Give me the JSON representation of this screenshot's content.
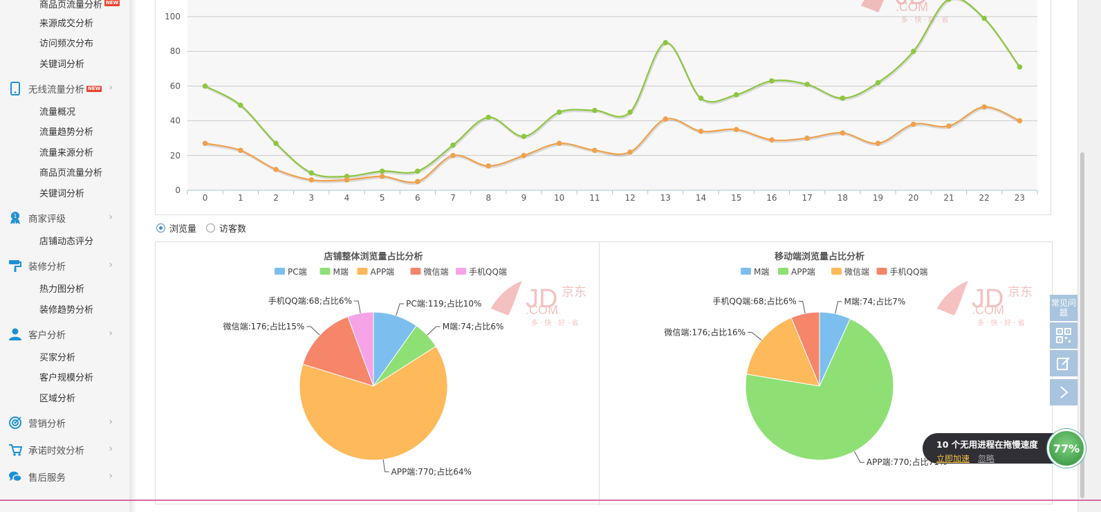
{
  "sidebar": {
    "top_item": {
      "label": "商品页流量分析",
      "badge": "NEW"
    },
    "group1_items": [
      "来源成交分析",
      "访问频次分布",
      "关键词分析"
    ],
    "wireless": {
      "label": "无线流量分析",
      "badge": "NEW",
      "items": [
        "流量概况",
        "流量趋势分析",
        "流量来源分析",
        "商品页流量分析",
        "关键词分析"
      ]
    },
    "rating": {
      "label": "商家评级",
      "items": [
        "店铺动态评分"
      ]
    },
    "decor": {
      "label": "装修分析",
      "items": [
        "热力图分析",
        "装修趋势分析"
      ]
    },
    "customer": {
      "label": "客户分析",
      "items": [
        "买家分析",
        "客户规模分析",
        "区域分析"
      ]
    },
    "marketing": {
      "label": "营销分析"
    },
    "promise": {
      "label": "承诺时效分析"
    },
    "aftersale": {
      "label": "售后服务"
    },
    "arrow": "›"
  },
  "radios": [
    {
      "label": "浏览量",
      "checked": true
    },
    {
      "label": "访客数",
      "checked": false
    }
  ],
  "watermark": {
    "jd": "JD",
    "cn": "京东",
    "com": ".COM",
    "slogan": "多 · 快 · 好 · 省"
  },
  "colors": {
    "green": "#8dc63f",
    "orange": "#f0a04b",
    "pc": "#7cbfef",
    "m": "#8ee074",
    "app": "#fdb95a",
    "wechat": "#f6866a",
    "qq": "#f7a3e8"
  },
  "chart_data": [
    {
      "type": "line",
      "x": [
        0,
        1,
        2,
        3,
        4,
        5,
        6,
        7,
        8,
        9,
        10,
        11,
        12,
        13,
        14,
        15,
        16,
        17,
        18,
        19,
        20,
        21,
        22,
        23
      ],
      "ylim": [
        0,
        110
      ],
      "yticks": [
        0,
        20,
        40,
        60,
        80,
        100
      ],
      "grid": true,
      "series": [
        {
          "values": [
            60,
            49,
            27,
            10,
            8,
            11,
            11,
            26,
            42,
            31,
            45,
            46,
            45,
            85,
            53,
            55,
            63,
            61,
            53,
            62,
            80,
            110,
            99,
            71
          ]
        },
        {
          "values": [
            27,
            23,
            12,
            6,
            6,
            8,
            5,
            20,
            14,
            20,
            27,
            23,
            22,
            41,
            34,
            35,
            29,
            30,
            33,
            27,
            38,
            37,
            48,
            40
          ]
        }
      ]
    },
    {
      "type": "pie",
      "title": "店铺整体浏览量占比分析",
      "legend": [
        "PC端",
        "M端",
        "APP端",
        "微信端",
        "手机QQ端"
      ],
      "values": [
        119,
        74,
        770,
        176,
        68
      ],
      "labels": [
        "PC端:119;占比10%",
        "M端:74;占比6%",
        "APP端:770;占比64%",
        "微信端:176;占比15%",
        "手机QQ端:68;占比6%"
      ]
    },
    {
      "type": "pie",
      "title": "移动端浏览量占比分析",
      "legend": [
        "M端",
        "APP端",
        "微信端",
        "手机QQ端"
      ],
      "values": [
        74,
        770,
        176,
        68
      ],
      "labels": [
        "M端:74;占比7%",
        "APP端:770;占比71%",
        "微信端:176;占比16%",
        "手机QQ端:68;占比6%"
      ]
    }
  ],
  "tools": {
    "faq": "常见问题",
    "qr": "qr-code-icon",
    "edit": "edit-icon",
    "next": "chevron-right-icon"
  },
  "notice": {
    "title": "10 个无用进程在拖慢速度",
    "action": "立即加速",
    "ignore": "忽略",
    "percent": "77%"
  }
}
